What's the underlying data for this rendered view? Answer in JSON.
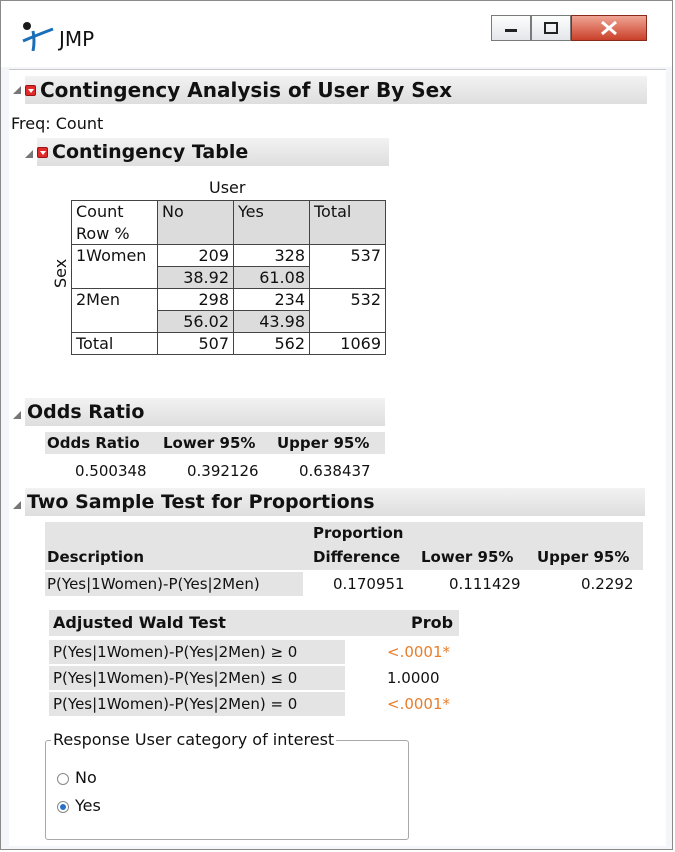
{
  "window": {
    "title": "JMP"
  },
  "report": {
    "title": "Contingency Analysis of User By Sex",
    "freq_label": "Freq: Count"
  },
  "contingency": {
    "title": "Contingency Table",
    "col_var": "User",
    "row_var": "Sex",
    "header": [
      "Count",
      "No",
      "Yes",
      "Total"
    ],
    "header2": "Row %",
    "rows": [
      {
        "label": "1Women",
        "no": "209",
        "yes": "328",
        "total": "537",
        "no_pct": "38.92",
        "yes_pct": "61.08"
      },
      {
        "label": "2Men",
        "no": "298",
        "yes": "234",
        "total": "532",
        "no_pct": "56.02",
        "yes_pct": "43.98"
      }
    ],
    "total_row": {
      "label": "Total",
      "no": "507",
      "yes": "562",
      "total": "1069"
    }
  },
  "odds": {
    "title": "Odds Ratio",
    "headers": [
      "Odds Ratio",
      "Lower 95%",
      "Upper 95%"
    ],
    "values": [
      "0.500348",
      "0.392126",
      "0.638437"
    ]
  },
  "twosample": {
    "title": "Two Sample Test for Proportions",
    "col_description": "Description",
    "col_diff_top": "Proportion",
    "col_diff": "Difference",
    "col_lower": "Lower 95%",
    "col_upper": "Upper 95%",
    "row": {
      "desc": "P(Yes|1Women)-P(Yes|2Men)",
      "diff": "0.170951",
      "lower": "0.111429",
      "upper": "0.2292"
    }
  },
  "wald": {
    "title": "Adjusted Wald Test",
    "prob_header": "Prob",
    "rows": [
      {
        "label": "P(Yes|1Women)-P(Yes|2Men) ≥ 0",
        "prob": "<.0001*"
      },
      {
        "label": "P(Yes|1Women)-P(Yes|2Men) ≤ 0",
        "prob": "1.0000"
      },
      {
        "label": "P(Yes|1Women)-P(Yes|2Men) = 0",
        "prob": "<.0001*"
      }
    ]
  },
  "response": {
    "legend": "Response User category of interest",
    "options": [
      "No",
      "Yes"
    ],
    "selected": "Yes"
  },
  "colors": {
    "significant": "#e87e2c",
    "red_button": "#e12a2a",
    "close": "#c9402a"
  }
}
